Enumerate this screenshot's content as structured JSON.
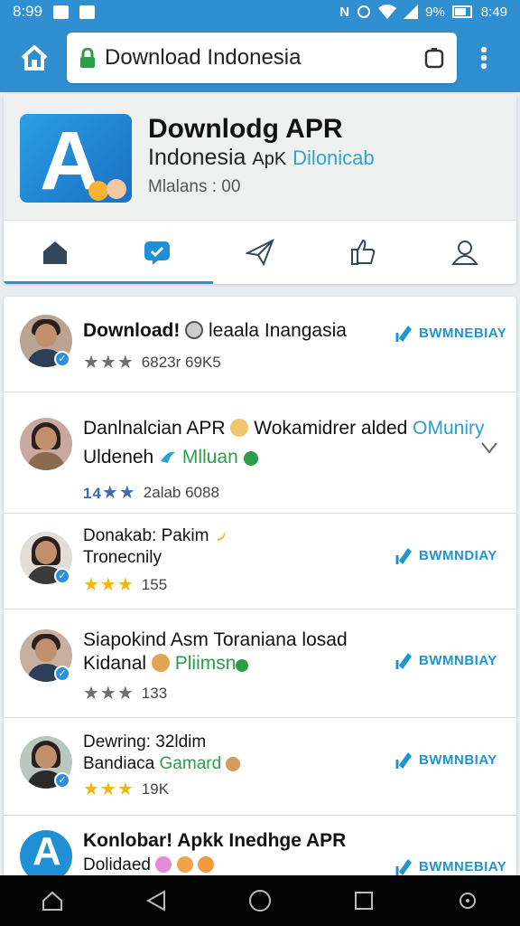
{
  "status_bar": {
    "time": "8:99",
    "right_text": "9%",
    "battery_text": "8:49",
    "letter": "N"
  },
  "browser": {
    "url_text": "Download Indonesia"
  },
  "header": {
    "title": "Downlodg APR",
    "subtitle_main": "Indonesia",
    "subtitle_small": "ApK",
    "subtitle_accent": "Dilonicab",
    "meta": "Mlalans : 00",
    "tabs": [
      "home",
      "chat",
      "send",
      "like",
      "profile"
    ]
  },
  "list": [
    {
      "title": "Download! ",
      "title_rest": "leaala Inangasia",
      "rating_value": "6823r 69K5",
      "star_style": "gray",
      "star_text": "★★★",
      "download_label": "BWMNEBIAY"
    },
    {
      "title": "Danlnalcian APR ",
      "title_rest": "Wokamidrer alded",
      "title_accent": "OMuniry",
      "line2": "Uldeneh",
      "line2_green": "Mlluan",
      "rating_prefix": "14",
      "rating_value": "2alab 6088",
      "star_style": "blue",
      "star_text": "★★"
    },
    {
      "title": "Donakab: Pakim",
      "line2": "Tronecnily",
      "rating_value": "155",
      "star_style": "gold",
      "star_text": "★★★",
      "download_label": "BWMNDIAY"
    },
    {
      "title": "Siapokind Asm Toraniana losad",
      "line2": "Kidanal",
      "line2_green": "Pliimsn",
      "rating_value": "133",
      "star_style": "gray",
      "star_text": "★★★",
      "download_label": "BWMNBIAY"
    },
    {
      "title": "Dewring: 32ldim",
      "line2": "Bandiaca",
      "line2_green": "Gamard",
      "rating_value": "19K",
      "star_style": "gold",
      "star_text": "★★★",
      "download_label": "BWMNBIAY"
    },
    {
      "title": "Konlobar! Apkk Inedhge APR",
      "line2": "Dolidaed",
      "download_label": "BWMNEBIAY"
    }
  ],
  "colors": {
    "accent": "#2f8fd0",
    "nav": "#050505",
    "green": "#2b9e4a",
    "download": "#1f95cf"
  }
}
